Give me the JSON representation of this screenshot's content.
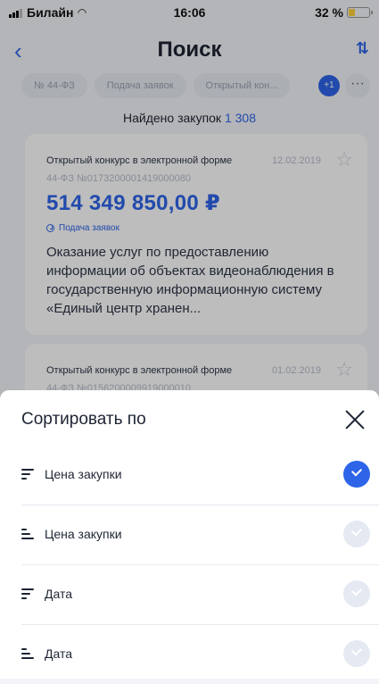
{
  "status_bar": {
    "carrier": "Билайн",
    "time": "16:06",
    "battery": "32 %",
    "battery_level": 0.32
  },
  "nav": {
    "back": "‹",
    "title": "Поиск",
    "sort": "⇅"
  },
  "filters": {
    "chips": [
      "№ 44-ФЗ",
      "Подача заявок",
      "Открытый кон..."
    ],
    "badge": "+1",
    "more": "···"
  },
  "results": {
    "found_label": "Найдено закупок",
    "found_count": "1 308"
  },
  "cards": [
    {
      "type": "Открытый конкурс в электронной форме",
      "date": "12.02.2019",
      "number": "44-ФЗ №0173200001419000080",
      "price": "514 349 850,00 ₽",
      "stage": "Подача заявок",
      "description": "Оказание услуг по предоставлению информации об объектах видеонаблюдения в государственную информационную систему «Единый центр хранен..."
    },
    {
      "type": "Открытый конкурс в электронной форме",
      "date": "01.02.2019",
      "number": "44-ФЗ №0156200009919000010"
    }
  ],
  "sort_sheet": {
    "title": "Сортировать по",
    "options": [
      {
        "label": "Цена закупки",
        "direction": "desc",
        "selected": true
      },
      {
        "label": "Цена закупки",
        "direction": "asc",
        "selected": false
      },
      {
        "label": "Дата",
        "direction": "desc",
        "selected": false
      },
      {
        "label": "Дата",
        "direction": "asc",
        "selected": false
      }
    ]
  },
  "colors": {
    "accent": "#2d64e8",
    "background": "#f3f5f9",
    "text": "#1d2433"
  }
}
